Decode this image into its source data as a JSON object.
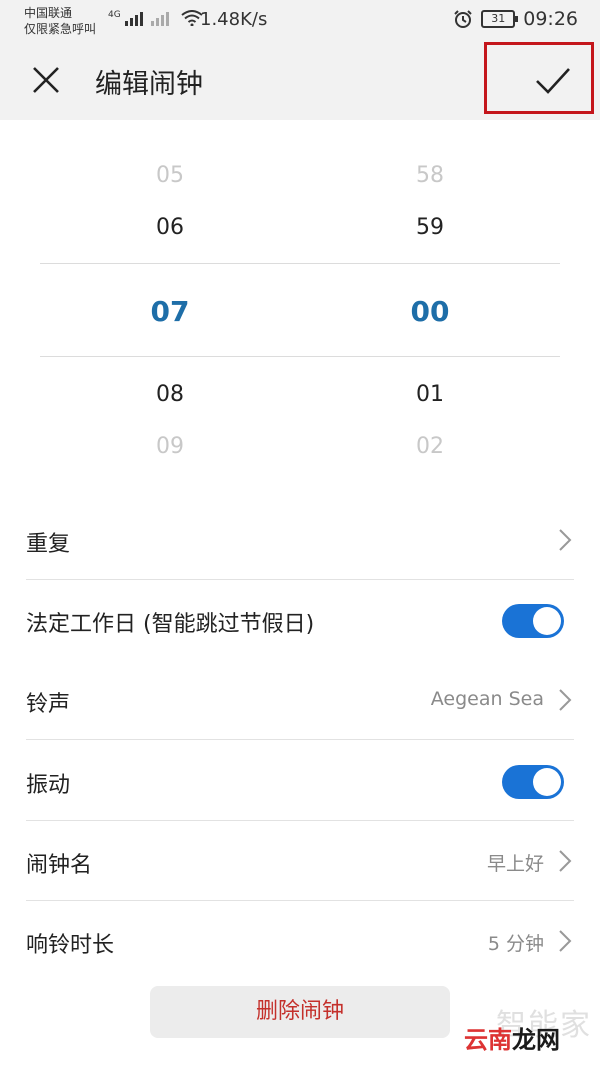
{
  "status_bar": {
    "carrier_line1": "中国联通",
    "carrier_line2": "仅限紧急呼叫",
    "network_label": "4G",
    "speed": "1.48K/s",
    "battery": "31",
    "time": "09:26"
  },
  "header": {
    "title": "编辑闹钟"
  },
  "picker": {
    "hours": [
      "05",
      "06",
      "07",
      "08",
      "09"
    ],
    "minutes": [
      "58",
      "59",
      "00",
      "01",
      "02"
    ],
    "selected_hour": "07",
    "selected_minute": "00"
  },
  "settings": [
    {
      "label": "重复",
      "value": "",
      "type": "chevron"
    },
    {
      "label": "法定工作日 (智能跳过节假日)",
      "type": "toggle",
      "on": true
    },
    {
      "label": "铃声",
      "value": "Aegean Sea",
      "type": "chevron"
    },
    {
      "label": "振动",
      "type": "toggle",
      "on": true
    },
    {
      "label": "闹钟名",
      "value": "早上好",
      "type": "chevron"
    },
    {
      "label": "响铃时长",
      "value": "5 分钟",
      "type": "chevron"
    }
  ],
  "delete_label": "删除闹钟",
  "watermark": {
    "faint": "智能家",
    "part1": "云南",
    "part2": "龙网"
  },
  "colors": {
    "accent": "#1a73d6",
    "selected_time": "#1e6ea8",
    "danger": "#c4302b",
    "highlight_box": "#c4161c"
  },
  "icons": [
    "close-icon",
    "check-icon",
    "chevron-right-icon",
    "alarm-icon",
    "wifi-icon",
    "signal-icon",
    "battery-icon"
  ]
}
